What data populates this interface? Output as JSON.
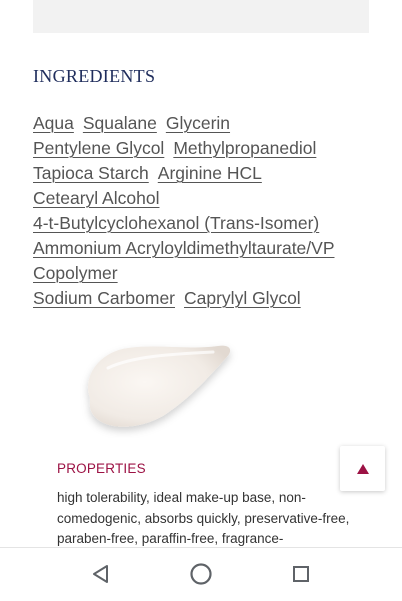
{
  "ingredients": {
    "title": "INGREDIENTS",
    "lines": [
      [
        "Aqua",
        "Squalane",
        "Glycerin"
      ],
      [
        "Pentylene Glycol",
        "Methylpropanediol"
      ],
      [
        "Tapioca Starch",
        "Arginine HCL"
      ],
      [
        "Cetearyl Alcohol"
      ],
      [
        "4-t-Butylcyclohexanol (Trans-Isomer)"
      ],
      [
        "Ammonium Acryloyldimethyltaurate/VP"
      ],
      [
        "Copolymer"
      ],
      [
        "Sodium Carbomer",
        "Caprylyl Glycol"
      ]
    ]
  },
  "properties": {
    "title": "PROPERTIES",
    "text": "high tolerability, ideal make-up base, non-comedogenic, absorbs quickly, preservative-free, paraben-free, paraffin-free, fragrance-"
  },
  "icons": {
    "scroll_top": "triangle-up-icon",
    "nav_back": "back-triangle-icon",
    "nav_home": "home-circle-icon",
    "nav_recents": "recents-square-icon"
  },
  "colors": {
    "ingredients_title": "#1f2d5c",
    "properties_title": "#9c1244",
    "link_text": "#555555"
  }
}
